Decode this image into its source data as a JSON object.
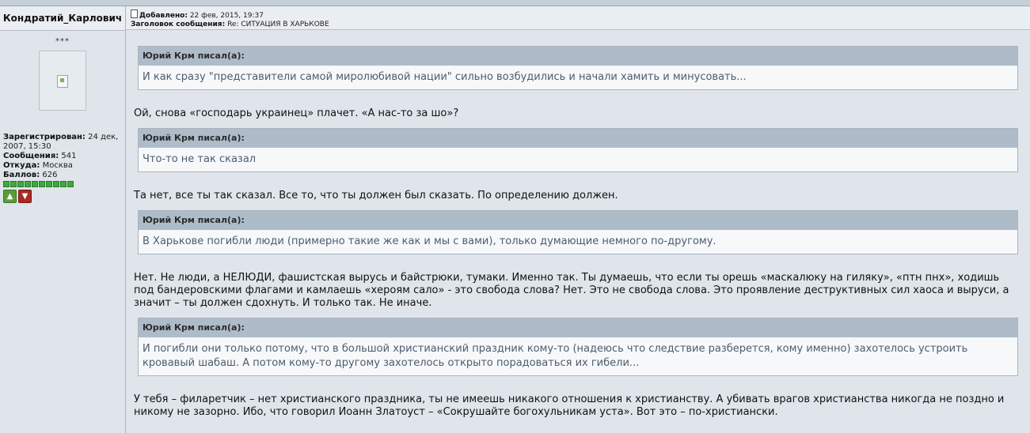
{
  "author": {
    "name": "Кондратий_Карлович",
    "rank": "***",
    "registered_label": "Зарегистрирован:",
    "registered_value": "24 дек, 2007, 15:30",
    "posts_label": "Сообщения:",
    "posts_value": "541",
    "from_label": "Откуда:",
    "from_value": "Москва",
    "points_label": "Баллов:",
    "points_value": "626",
    "rating_pips": 10
  },
  "header": {
    "added_label": "Добавлено:",
    "added_value": "22 фев, 2015, 19:37",
    "subject_label": "Заголовок сообщения:",
    "subject_value": "Re: СИТУАЦИЯ В ХАРЬКОВЕ"
  },
  "content": [
    {
      "quote_author": "Юрий Крм писал(а):",
      "quote_text": "И как сразу \"представители самой миролюбивой нации\" сильно возбудились и начали хамить и минусовать...",
      "reply": "Ой, снова «господарь украинец» плачет. «А нас-то за шо»?"
    },
    {
      "quote_author": "Юрий Крм писал(а):",
      "quote_text": "Что-то не так сказал",
      "reply": "Та нет, все ты так сказал. Все то, что ты должен был сказать. По определению должен."
    },
    {
      "quote_author": "Юрий Крм писал(а):",
      "quote_text": "В Харькове погибли люди (примерно такие же как и мы с вами), только думающие немного по-другому.",
      "reply": "Нет. Не люди, а НЕЛЮДИ, фашистская вырусь и байстрюки, тумаки. Именно так. Ты думаешь, что если ты орешь «маскалюку на гиляку», «птн пнх», ходишь под бандеровскими флагами и камлаешь «хероям сало» - это свобода слова? Нет. Это не свобода слова. Это проявление деструктивных сил хаоса и выруси, а значит – ты должен сдохнуть. И только так. Не иначе."
    },
    {
      "quote_author": "Юрий Крм писал(а):",
      "quote_text": "И погибли они только потому, что в большой христианский праздник кому-то (надеюсь что следствие разберется, кому именно) захотелось устроить кровавый шабаш. А потом кому-то другому захотелось открыто порадоваться их гибели...",
      "reply": "У тебя – филаретчик – нет христианского праздника, ты не имеешь никакого отношения к христианству. А убивать врагов христианства никогда не поздно и никому не зазорно. Ибо, что говорил Иоанн Златоуст – «Сокрушайте богохульникам уста». Вот это – по-христиански."
    }
  ]
}
